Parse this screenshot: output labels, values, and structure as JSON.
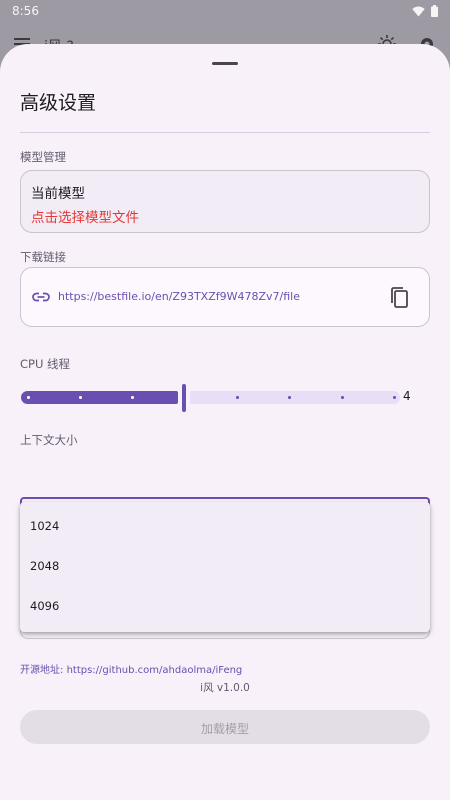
{
  "status_bar": {
    "time": "8:56"
  },
  "under_app": {
    "title": "i风 ?"
  },
  "sheet": {
    "title": "高级设置",
    "model_section": {
      "label": "模型管理",
      "card_title": "当前模型",
      "card_action": "点击选择模型文件"
    },
    "download_section": {
      "label": "下载链接",
      "url": "https://bestfile.io/en/Z93TXZf9W478Zv7/file"
    },
    "cpu_section": {
      "label": "CPU 线程",
      "value": "4",
      "slider_fraction": 0.43
    },
    "context_section": {
      "label": "上下文大小",
      "selected": "2048",
      "options": [
        "1024",
        "2048",
        "4096"
      ]
    },
    "footer": {
      "source_label": "开源地址:",
      "source_url": "https://github.com/ahdaolma/iFeng",
      "version": "i风 v1.0.0"
    },
    "load_button": "加载模型"
  },
  "colors": {
    "accent": "#6a4fb0",
    "error": "#e53935",
    "sheet_background": "#f8f1f9"
  }
}
